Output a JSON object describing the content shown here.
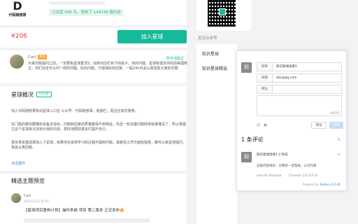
{
  "main": {
    "logo_caption": "代码随想录",
    "stats_badge": "已运营 999 天，更新了 144238 篇内容",
    "price": "¥206",
    "join_button": "加入星球",
    "featured_comment": {
      "name": "Carl",
      "tag": "星主",
      "date": "昨天活跃过",
      "text": "大家向我提问之前，一定要看星球置顶3，找到对应栏目下的帖子，你的问题，星球有很多你的前辈遇到过，你们完全可以问一样的问题。好的问题，才值得好的回答，一般24h内会认真回复大家的问题"
    },
    "overview_title": "星球概况",
    "verified_label": "已认证",
    "overview_intro": "加入代码随想录知识星球入口在 公众号：代码随想录，底部栏，而且还有优惠券。",
    "overview_p1": "先门槛的微信群确实会鱼龙混杂，问题和回答的质量都得不到保证。而且一些关键问题经常就被淹没了，所以我建立这个星球来沉淀有价值的内容，更好地帮助录友们提升自己。",
    "overview_p2": "很多录友都选择加入了星球，如果你在系统学习的过程中遇到问题，或者找工作方面有疑惑，都可以来星球提问，我会认真回答。",
    "expand_link": "点击展开",
    "featured_title": "精选主题预览",
    "post": {
      "name": "Carl",
      "date": "2024/12/13 06:00",
      "text": "【星球项目重构计划】操作系统 项目 第二版本 正式发布🔥"
    }
  },
  "side": {
    "label": "关注公众号",
    "items": [
      "知识星球",
      "知识星球精选"
    ]
  },
  "popup": {
    "avatar_char": "知",
    "fields": [
      {
        "label": "昵称",
        "value": "知识星球读者1"
      },
      {
        "label": "邮箱",
        "value": "abc@qq.com"
      },
      {
        "label": "网址",
        "value": ""
      }
    ],
    "textarea_count": "0/8192",
    "preview_button": "预览",
    "send_button": "发送",
    "comment_count": "1 条评论",
    "comment": {
      "avatar_char": "知",
      "name": "知识星球读者1 0 秒前",
      "text": "这篇内容很好，对我有一定帮助，认可作者",
      "os": "macOS Sequoia",
      "browser": "Chrome 131.0.0.0"
    },
    "powered_by": "Powered by",
    "powered_brand": "Twikoo v1.6.40"
  },
  "colors": {
    "accent": "#16b998",
    "price": "#e8453c",
    "tag": "#f7a23b"
  }
}
